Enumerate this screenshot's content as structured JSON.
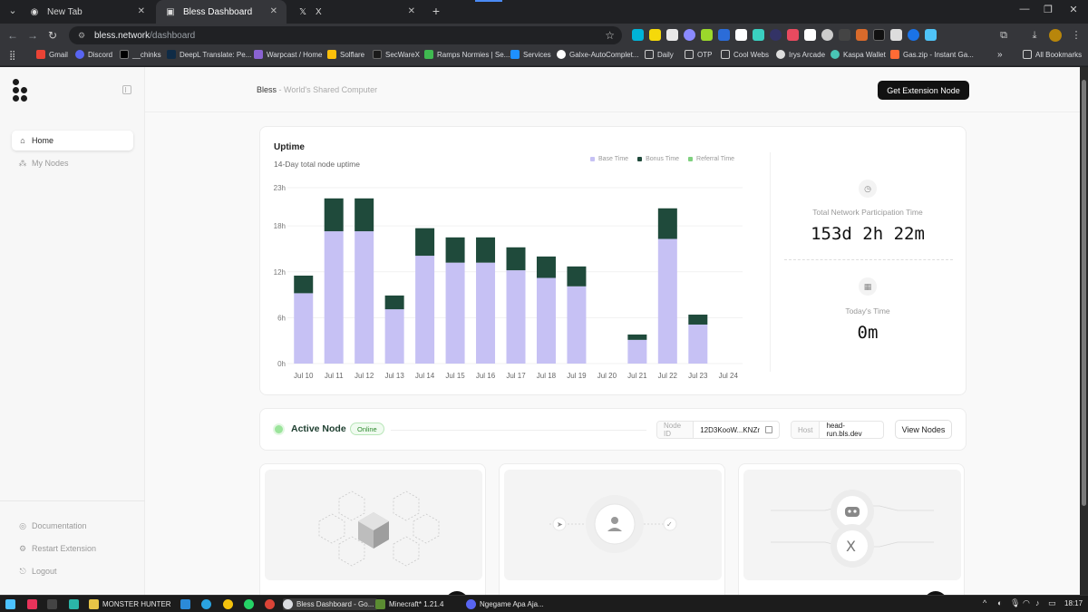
{
  "browser": {
    "tabs": [
      {
        "title": "New Tab",
        "active": false
      },
      {
        "title": "Bless Dashboard",
        "active": true
      },
      {
        "title": "X",
        "active": false
      }
    ],
    "url_host": "bless.network",
    "url_path": "/dashboard",
    "bookmarks": [
      {
        "label": "Gmail",
        "color": "#ea4335"
      },
      {
        "label": "Discord",
        "color": "#5865f2"
      },
      {
        "label": "__chinks",
        "color": "#000000"
      },
      {
        "label": "DeepL Translate: Pe...",
        "color": "#0f2b46"
      },
      {
        "label": "Warpcast / Home",
        "color": "#8a63d2"
      },
      {
        "label": "Solflare",
        "color": "#fcc00a"
      },
      {
        "label": "SecWareX",
        "color": "#1a1a1a"
      },
      {
        "label": "Ramps Normies | Se...",
        "color": "#3fb950"
      },
      {
        "label": "Services",
        "color": "#1e90ff"
      },
      {
        "label": "Galxe-AutoComplet...",
        "color": "#ffffff"
      },
      {
        "label": "Daily",
        "color": "folder"
      },
      {
        "label": "OTP",
        "color": "folder"
      },
      {
        "label": "Cool Webs",
        "color": "folder"
      },
      {
        "label": "Irys Arcade",
        "color": "#dddddd"
      },
      {
        "label": "Kaspa Wallet",
        "color": "#49c5b6"
      },
      {
        "label": "Gas.zip - Instant Ga...",
        "color": "#ff6b35"
      }
    ],
    "all_bookmarks": "All Bookmarks"
  },
  "sidebar": {
    "items": [
      {
        "label": "Home",
        "icon": "home-icon",
        "active": true
      },
      {
        "label": "My Nodes",
        "icon": "nodes-icon",
        "active": false
      }
    ],
    "bottom_items": [
      {
        "label": "Documentation",
        "icon": "docs-icon"
      },
      {
        "label": "Restart Extension",
        "icon": "restart-icon"
      },
      {
        "label": "Logout",
        "icon": "logout-icon"
      }
    ]
  },
  "header": {
    "brand": "Bless",
    "tagline": " - World's Shared Computer",
    "cta": "Get Extension Node"
  },
  "uptime": {
    "title": "Uptime",
    "subtitle": "14-Day total node uptime",
    "total_label": "Total Network Participation Time",
    "total_value": "153d 2h 22m",
    "today_label": "Today's Time",
    "today_value": "0m"
  },
  "chart_data": {
    "type": "bar",
    "stacked": true,
    "categories": [
      "Jul 10",
      "Jul 11",
      "Jul 12",
      "Jul 13",
      "Jul 14",
      "Jul 15",
      "Jul 16",
      "Jul 17",
      "Jul 18",
      "Jul 19",
      "Jul 20",
      "Jul 21",
      "Jul 22",
      "Jul 23",
      "Jul 24"
    ],
    "series": [
      {
        "name": "Base Time",
        "color": "#c6c1f4",
        "values": [
          9.2,
          17.3,
          17.3,
          7.1,
          14.1,
          13.2,
          13.2,
          12.2,
          11.2,
          10.1,
          0,
          3.1,
          16.3,
          5.1,
          0
        ]
      },
      {
        "name": "Bonus Time",
        "color": "#1f4a3b",
        "values": [
          2.3,
          4.3,
          4.3,
          1.8,
          3.6,
          3.3,
          3.3,
          3.0,
          2.8,
          2.6,
          0,
          0.7,
          4.0,
          1.3,
          0
        ]
      },
      {
        "name": "Referral Time",
        "color": "#7fd17f",
        "values": [
          0,
          0,
          0,
          0,
          0,
          0,
          0,
          0,
          0,
          0,
          0,
          0,
          0,
          0,
          0
        ]
      }
    ],
    "y_ticks": [
      "0h",
      "6h",
      "12h",
      "18h",
      "23h"
    ],
    "ylim": [
      0,
      23
    ],
    "grid": true,
    "legend": "top-right"
  },
  "node": {
    "title": "Active Node",
    "status": "Online",
    "id_label": "Node ID",
    "id_value": "12D3KooW...KNZr",
    "host_label": "Host",
    "host_value": "head-run.bls.dev",
    "view_button": "View Nodes"
  },
  "taskbar": {
    "items": [
      {
        "label": "MONSTER HUNTER",
        "color": "#e8c547"
      },
      {
        "label": "Bless Dashboard - Go...",
        "color": "#dadce0",
        "active": true
      },
      {
        "label": "Minecraft* 1.21.4",
        "color": "#5b8c32"
      },
      {
        "label": "Ngegame Apa Aja...",
        "color": "#5865f2"
      }
    ],
    "clock": "18:17"
  }
}
